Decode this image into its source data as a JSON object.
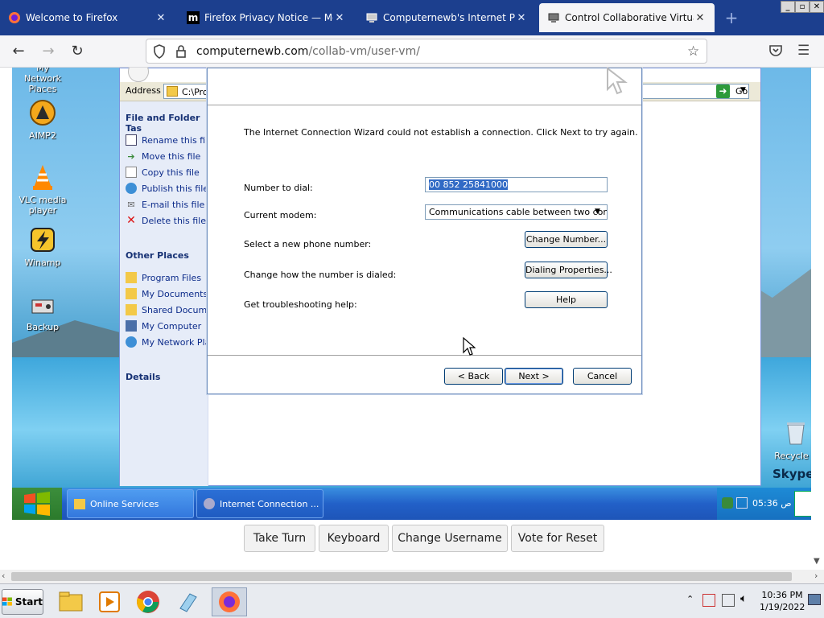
{
  "browser": {
    "tabs": [
      {
        "label": "Welcome to Firefox",
        "icon": "firefox-icon"
      },
      {
        "label": "Firefox Privacy Notice — Mozilla",
        "icon": "mozilla-m-icon"
      },
      {
        "label": "Computernewb's Internet Pub Hub",
        "icon": "computernewb-icon"
      },
      {
        "label": "Control Collaborative Virtual Machi",
        "icon": "computernewb-icon"
      }
    ],
    "tab_close": "✕",
    "new_tab": "+",
    "url_domain": "computernewb.com",
    "url_path": "/collab-vm/user-vm/",
    "window_buttons": [
      "_",
      "▫",
      "✕"
    ]
  },
  "desktop": {
    "icons": [
      {
        "label": "My Network Places"
      },
      {
        "label": "AIMP2"
      },
      {
        "label": "VLC media player"
      },
      {
        "label": "Winamp"
      },
      {
        "label": "Backup"
      },
      {
        "label": "Recycle B"
      }
    ],
    "skype_label": "Skype"
  },
  "explorer": {
    "address_label": "Address",
    "address_value": "C:\\Prog",
    "go_label": "Go",
    "tasks_heading": "File and Folder Tas",
    "tasks": [
      "Rename this file",
      "Move this file",
      "Copy this file",
      "Publish this file t",
      "E-mail this file",
      "Delete this file"
    ],
    "places_heading": "Other Places",
    "places": [
      "Program Files",
      "My Documents",
      "Shared Documen",
      "My Computer",
      "My Network Plac"
    ],
    "details_heading": "Details"
  },
  "wizard": {
    "message": "The Internet Connection Wizard could not establish a connection. Click Next to try again.",
    "number_label": "Number to dial:",
    "number_value": "00 852 25841000",
    "modem_label": "Current modem:",
    "modem_value": "Communications cable between two comp",
    "new_number_label": "Select a new phone number:",
    "change_number_button": "Change Number...",
    "dial_label": "Change how the number is dialed:",
    "dialing_properties_button": "Dialing Properties...",
    "help_label": "Get troubleshooting help:",
    "help_button": "Help",
    "back_button": "< Back",
    "next_button": "Next >",
    "cancel_button": "Cancel"
  },
  "guest_taskbar": {
    "buttons": [
      "Online Services",
      "Internet Connection ..."
    ],
    "clock": "05:36 ص"
  },
  "vm_controls": [
    "Take Turn",
    "Keyboard",
    "Change Username",
    "Vote for Reset"
  ],
  "host_taskbar": {
    "start_label": "Start",
    "time": "10:36 PM",
    "date": "1/19/2022"
  }
}
